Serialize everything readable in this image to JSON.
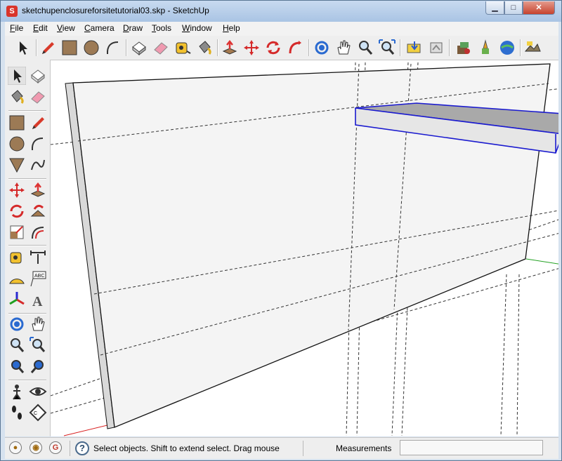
{
  "window": {
    "title": "sketchupenclosureforsitetutorial03.skp - SketchUp",
    "app_icon": "sketchup-logo-icon",
    "min_glyph": "▁",
    "max_glyph": "□",
    "close_glyph": "✕"
  },
  "menu": [
    "File",
    "Edit",
    "View",
    "Camera",
    "Draw",
    "Tools",
    "Window",
    "Help"
  ],
  "toolbar_top": [
    "select-arrow-icon",
    "pencil-line-icon",
    "rectangle-icon",
    "circle-icon",
    "arc-icon",
    "make-component-icon",
    "eraser-icon",
    "tape-measure-icon",
    "paint-bucket-icon",
    "push-pull-icon",
    "move-icon",
    "rotate-icon",
    "follow-me-icon",
    "orbit-icon",
    "pan-hand-icon",
    "zoom-icon",
    "zoom-extents-icon",
    "get-models-icon",
    "share-model-icon",
    "components-icon",
    "place-model-icon",
    "google-earth-icon",
    "toggle-terrain-icon"
  ],
  "toolbar_left": [
    "select-arrow-icon",
    "make-component-icon",
    "paint-bucket-icon",
    "eraser-icon",
    "rectangle-icon",
    "pencil-line-icon",
    "circle-icon",
    "arc-icon",
    "polygon-icon",
    "freehand-icon",
    "move-icon",
    "push-pull-icon",
    "rotate-icon",
    "follow-me-icon",
    "scale-icon",
    "offset-icon",
    "tape-measure-icon",
    "dimension-icon",
    "protractor-icon",
    "text-label-icon",
    "axes-icon",
    "3d-text-icon",
    "orbit-icon",
    "pan-hand-icon",
    "zoom-icon",
    "zoom-window-icon",
    "previous-view-icon",
    "next-view-icon",
    "position-camera-icon",
    "look-around-icon",
    "walk-icon",
    "section-plane-icon"
  ],
  "statusbar": {
    "icons": [
      "geo-location-icon",
      "credits-icon",
      "google-sign-in-icon"
    ],
    "help_glyph": "?",
    "message": "Select objects. Shift to extend select. Drag mouse",
    "measurements_label": "Measurements",
    "measurements_value": ""
  },
  "colors": {
    "title_bg": "#b7cde8",
    "toolbar_bg": "#eeeeee",
    "selection_blue": "#1a1acf",
    "axis_red": "#d82020",
    "axis_green": "#20a020"
  }
}
